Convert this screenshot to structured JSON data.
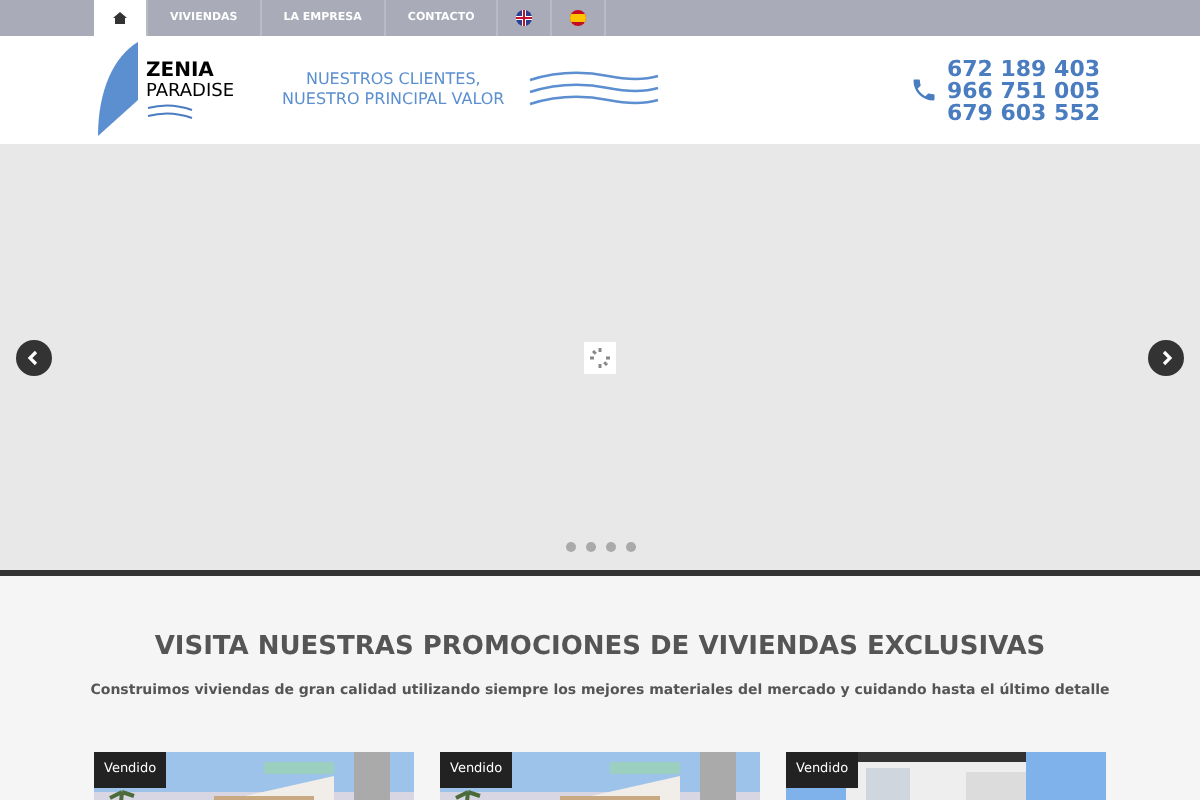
{
  "nav": [
    {
      "kind": "home",
      "selected": true
    },
    {
      "kind": "text",
      "label": "VIVIENDAS",
      "selected": false
    },
    {
      "kind": "text",
      "label": "LA EMPRESA",
      "selected": false
    },
    {
      "kind": "text",
      "label": "CONTACTO",
      "selected": false
    },
    {
      "kind": "flag-uk",
      "selected": false
    },
    {
      "kind": "flag-es",
      "selected": false
    }
  ],
  "logo": {
    "line1": "ZENIA",
    "line2": "PARADISE"
  },
  "slogan": [
    "NUESTROS CLIENTES,",
    "NUESTRO PRINCIPAL VALOR"
  ],
  "phones": [
    "672 189 403",
    "966 751 005",
    "679 603 552"
  ],
  "slider": {
    "dots": [
      {
        "selected": false
      },
      {
        "selected": false
      },
      {
        "selected": false
      },
      {
        "selected": false
      }
    ]
  },
  "section": {
    "title": "VISITA NUESTRAS PROMOCIONES DE VIVIENDAS EXCLUSIVAS",
    "subtitle": "Construimos viviendas de gran calidad utilizando siempre los mejores materiales del mercado y cuidando hasta el último detalle"
  },
  "cards": [
    {
      "badge": "Vendido",
      "kind": "picture"
    },
    {
      "badge": "Vendido",
      "kind": "picture"
    },
    {
      "badge": "Vendido",
      "kind": "picture"
    }
  ]
}
